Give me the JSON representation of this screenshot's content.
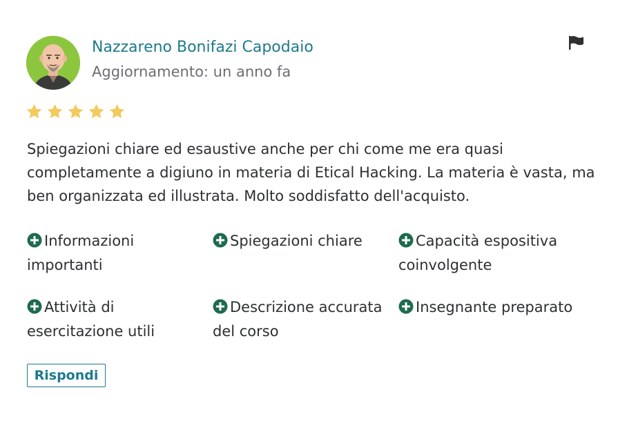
{
  "review": {
    "author": "Nazzareno Bonifazi Capodaio",
    "updated": "Aggiornamento: un anno fa",
    "rating": 5,
    "star_color": "#f3ca5e",
    "text": "Spiegazioni chiare ed esaustive anche per chi come me era quasi completamente a digiuno in materia di Etical Hacking. La materia è vasta, ma ben organizzata ed illustrata. Molto soddisfatto dell'acquisto.",
    "tags": [
      "Informazioni importanti",
      "Spiegazioni chiare",
      "Capacità espositiva coinvolgente",
      "Attività di esercitazione utili",
      "Descrizione accurata del corso",
      "Insegnante preparato"
    ],
    "reply_label": "Rispondi"
  },
  "icons": {
    "avatar": "avatar-icon",
    "flag": "flag-icon",
    "star": "star-icon",
    "tag": "plus-circle-icon"
  },
  "colors": {
    "accent": "#1d7a8c",
    "tag_icon": "#1f6b4f"
  }
}
